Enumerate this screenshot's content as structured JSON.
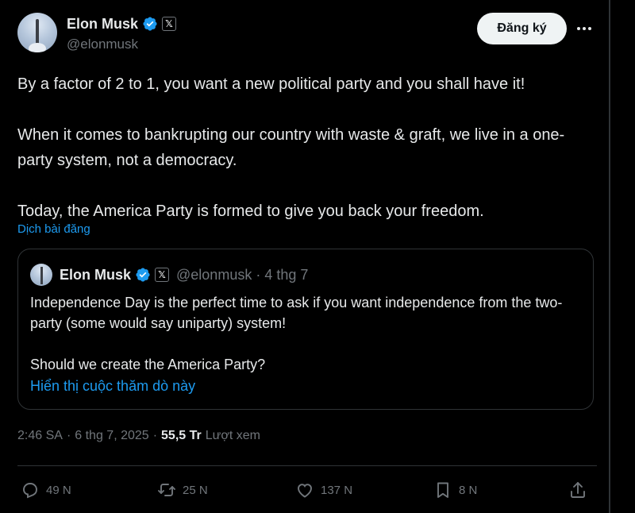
{
  "author": {
    "name": "Elon Musk",
    "handle": "@elonmusk",
    "verified_color": "#1d9bf0",
    "badge_icon": "x-logo-icon"
  },
  "follow_button": {
    "label": "Đăng ký"
  },
  "post": {
    "paragraphs": [
      "By a factor of 2 to 1, you want a new political party and you shall have it!",
      "When it comes to bankrupting our country with waste & graft, we live in a one-party system, not a democracy.",
      "Today, the America Party is formed to give you back your freedom."
    ],
    "translate_link": "Dịch bài đăng"
  },
  "quote": {
    "name": "Elon Musk",
    "handle_date": "@elonmusk · 4 thg 7",
    "paragraphs": [
      "Independence Day is the perfect time to ask if you want independence from the two-party (some would say uniparty) system!",
      "Should we create the America Party?"
    ],
    "poll_link": "Hiển thị cuộc thăm dò này"
  },
  "meta": {
    "time": "2:46 SA",
    "dot": "·",
    "date": "6 thg 7, 2025",
    "views_count": "55,5 Tr",
    "views_label": "Lượt xem"
  },
  "actions": {
    "replies": "49 N",
    "reposts": "25 N",
    "likes": "137 N",
    "bookmarks": "8 N"
  },
  "colors": {
    "background": "#000000",
    "text": "#e7e9ea",
    "muted": "#71767b",
    "accent": "#1d9bf0",
    "border": "#2f3336"
  }
}
